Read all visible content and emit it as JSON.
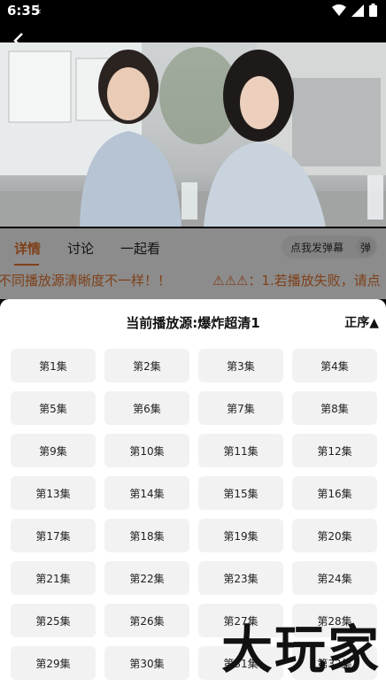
{
  "status_bar": {
    "time": "6:35",
    "download_icon": "download-icon",
    "icons": [
      "wifi-icon",
      "signal-icon",
      "battery-icon"
    ]
  },
  "player": {
    "back_icon": "chevron-left-icon"
  },
  "tabs": [
    {
      "label": "详情",
      "active": true
    },
    {
      "label": "讨论",
      "active": false
    },
    {
      "label": "一起看",
      "active": false
    }
  ],
  "danmu": {
    "label": "点我发弹幕",
    "toggle": "弹"
  },
  "notice": {
    "left": "不同播放源清晰度不一样！！",
    "right": "⚠⚠⚠：1.若播放失败，请点"
  },
  "sheet": {
    "title": "当前播放源:爆炸超清1",
    "order_label": "正序▲",
    "episodes": [
      "第1集",
      "第2集",
      "第3集",
      "第4集",
      "第5集",
      "第6集",
      "第7集",
      "第8集",
      "第9集",
      "第10集",
      "第11集",
      "第12集",
      "第13集",
      "第14集",
      "第15集",
      "第16集",
      "第17集",
      "第18集",
      "第19集",
      "第20集",
      "第21集",
      "第22集",
      "第23集",
      "第24集",
      "第25集",
      "第26集",
      "第27集",
      "第28集",
      "第29集",
      "第30集",
      "第31集",
      "第32集"
    ]
  },
  "watermark": "大玩家",
  "colors": {
    "accent": "#e8762e"
  }
}
